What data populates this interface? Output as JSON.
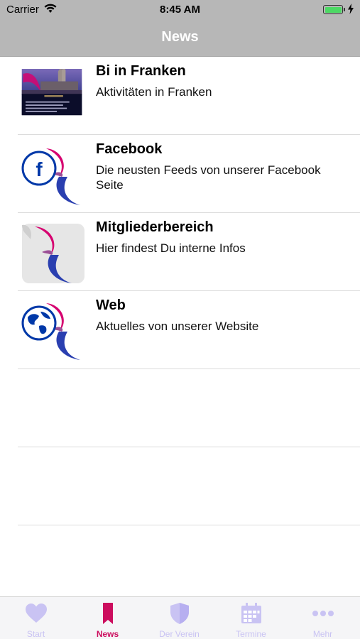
{
  "status": {
    "carrier": "Carrier",
    "time": "8:45 AM"
  },
  "nav": {
    "title": "News"
  },
  "rows": [
    {
      "title": "Bi in Franken",
      "subtitle": "Aktivitäten in Franken",
      "icon": "bi-in-franken-thumbnail"
    },
    {
      "title": "Facebook",
      "subtitle": "Die neusten Feeds von unserer Facebook Seite",
      "icon": "facebook-bi-logo-icon"
    },
    {
      "title": "Mitgliederbereich",
      "subtitle": "Hier findest Du interne Infos",
      "icon": "members-bi-logo-icon"
    },
    {
      "title": "Web",
      "subtitle": "Aktuelles von unserer Website",
      "icon": "globe-bi-logo-icon"
    }
  ],
  "tabs": [
    {
      "label": "Start",
      "icon": "heart-icon",
      "active": false
    },
    {
      "label": "News",
      "icon": "bookmark-icon",
      "active": true
    },
    {
      "label": "Der Verein",
      "icon": "shield-icon",
      "active": false
    },
    {
      "label": "Termine",
      "icon": "calendar-icon",
      "active": false
    },
    {
      "label": "Mehr",
      "icon": "more-dots-icon",
      "active": false
    }
  ],
  "colors": {
    "bar_gray": "#b7b7b7",
    "active_tab": "#cc0d5e",
    "inactive_tab": "#c9c3f3",
    "bi_pink": "#d60270",
    "bi_purple": "#9b4f96",
    "bi_blue": "#0038a8"
  }
}
